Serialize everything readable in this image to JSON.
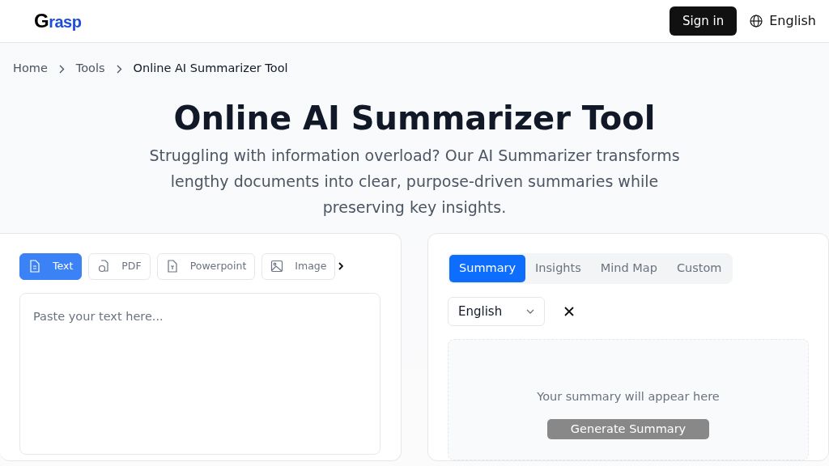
{
  "header": {
    "logo": "Grasp",
    "sign_in": "Sign in",
    "language": "English"
  },
  "breadcrumb": [
    "Home",
    "Tools",
    "Online AI Summarizer Tool"
  ],
  "hero": {
    "title": "Online AI Summarizer Tool",
    "subtitle": "Struggling with information overload? Our AI Summarizer transforms lengthy documents into clear, purpose-driven summaries while preserving key insights."
  },
  "input_tabs": [
    {
      "label": "Text",
      "kind": "text",
      "selected": true
    },
    {
      "label": "PDF",
      "kind": "pdf",
      "selected": false
    },
    {
      "label": "Powerpoint",
      "kind": "powerpoint",
      "selected": false
    },
    {
      "label": "Image",
      "kind": "image",
      "selected": false
    }
  ],
  "text_input": {
    "placeholder": "Paste your text here..."
  },
  "output_tabs": [
    {
      "label": "Summary",
      "selected": true
    },
    {
      "label": "Insights",
      "selected": false
    },
    {
      "label": "Mind Map",
      "selected": false
    },
    {
      "label": "Custom",
      "selected": false
    }
  ],
  "output_language": "English",
  "output": {
    "empty_text": "Your summary will appear here",
    "button": "Generate Summary"
  }
}
